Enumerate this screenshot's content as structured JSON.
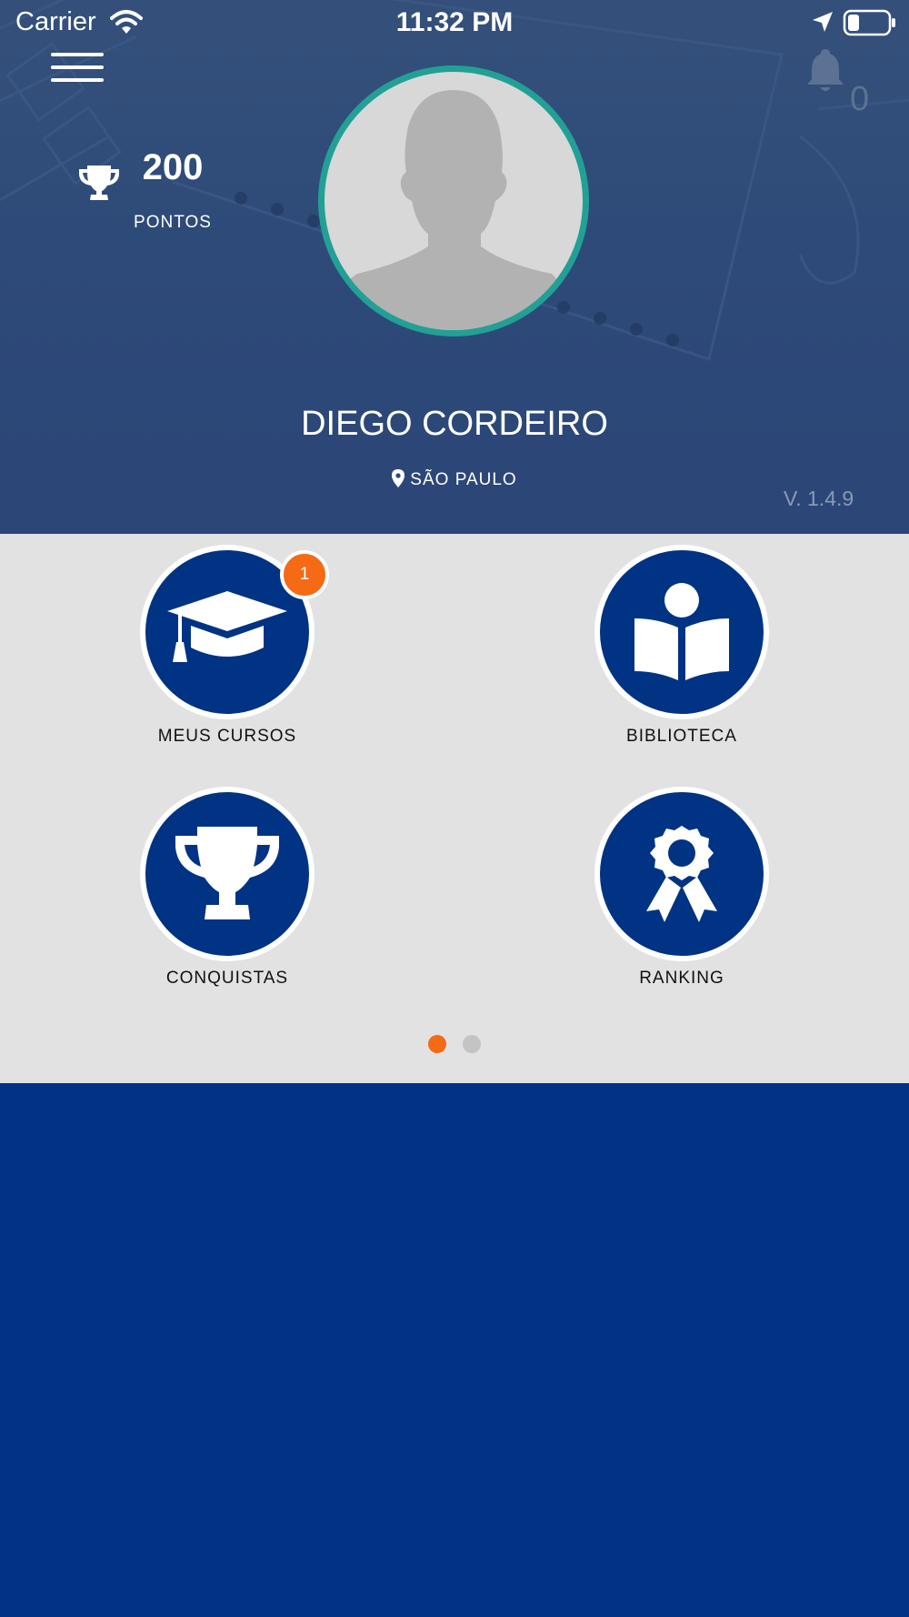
{
  "status_bar": {
    "carrier": "Carrier",
    "time": "11:32 PM",
    "wifi_icon": "wifi-icon",
    "location_icon": "location-arrow-icon",
    "battery_icon": "battery-icon"
  },
  "header": {
    "menu_icon": "hamburger-menu-icon",
    "notifications": {
      "icon": "bell-icon",
      "count": "0"
    },
    "points": {
      "icon": "trophy-icon",
      "value": "200",
      "label": "PONTOS"
    },
    "user": {
      "name": "DIEGO CORDEIRO",
      "city": "SÃO PAULO",
      "avatar_icon": "avatar-placeholder"
    },
    "version": "V. 1.4.9"
  },
  "menu_grid": {
    "items": [
      {
        "label": "MEUS CURSOS",
        "icon": "graduation-cap-icon",
        "badge": "1"
      },
      {
        "label": "BIBLIOTECA",
        "icon": "reader-book-icon"
      },
      {
        "label": "CONQUISTAS",
        "icon": "trophy-icon"
      },
      {
        "label": "RANKING",
        "icon": "award-ribbon-icon"
      }
    ],
    "page_indicator": {
      "pages": 2,
      "active": 1
    }
  },
  "colors": {
    "primary": "#003383",
    "accent": "#f46a15",
    "avatar_ring": "#22a095",
    "panel_bg": "#e2e2e2",
    "inactive_dot": "#c4c4c4"
  }
}
